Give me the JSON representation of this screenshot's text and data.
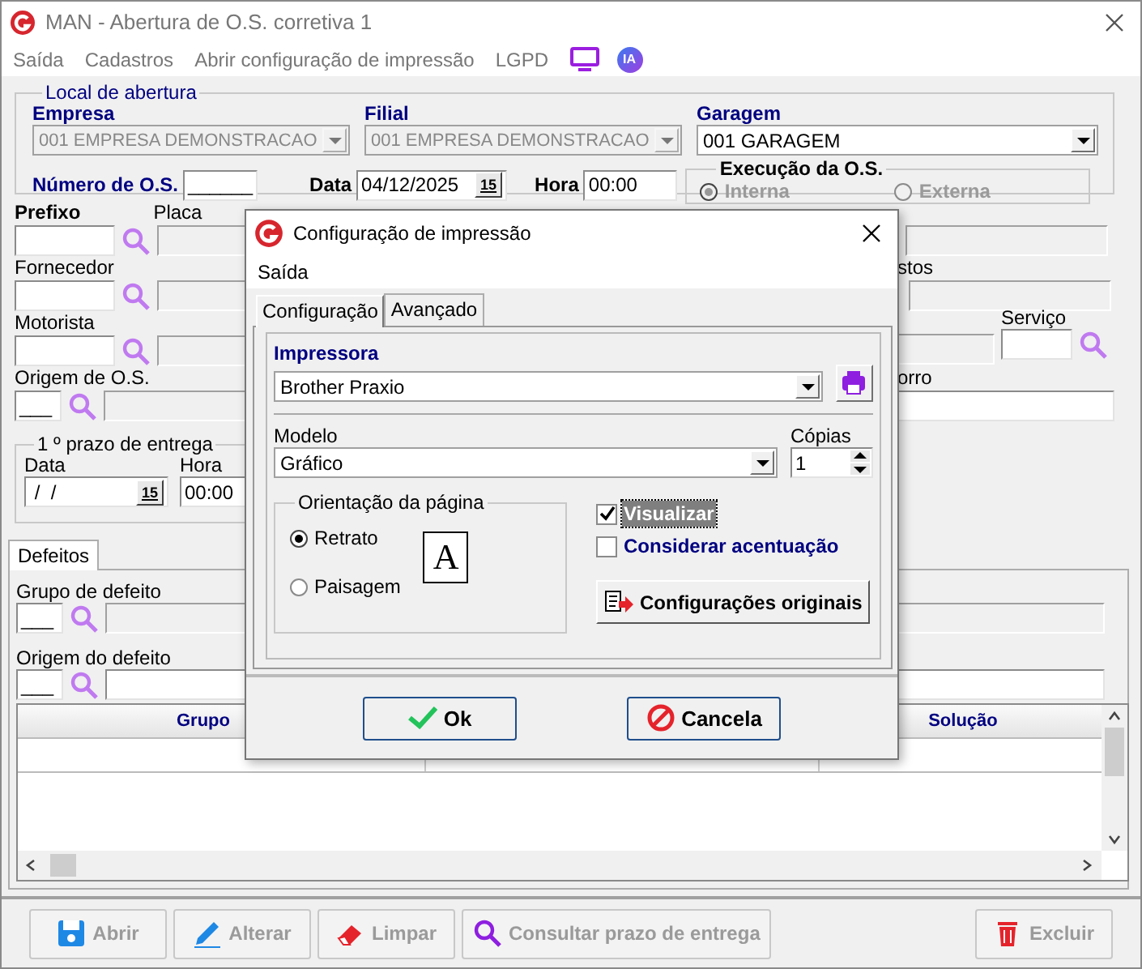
{
  "window": {
    "title": "MAN - Abertura de O.S. corretiva 1"
  },
  "menu": [
    {
      "label": "Saída"
    },
    {
      "label": "Cadastros"
    },
    {
      "label": "Abrir configuração de impressão"
    },
    {
      "label": "LGPD"
    }
  ],
  "menu_badge": "IA",
  "local_de_abertura": {
    "title": "Local de abertura",
    "empresa": {
      "label": "Empresa",
      "value": "001 EMPRESA DEMONSTRACAO",
      "disabled": true
    },
    "filial": {
      "label": "Filial",
      "value": "001 EMPRESA DEMONSTRACAO",
      "disabled": true
    },
    "garagem": {
      "label": "Garagem",
      "value": "001 GARAGEM",
      "disabled": false
    },
    "numero_os": {
      "label": "Número de O.S.",
      "value": "______"
    },
    "data": {
      "label": "Data",
      "value": "04/12/2025",
      "calendar": "15"
    },
    "hora": {
      "label": "Hora",
      "value": "00:00"
    },
    "execucao": {
      "title": "Execução da O.S.",
      "disabled": true,
      "options": [
        {
          "label": "Interna",
          "selected": true
        },
        {
          "label": "Externa",
          "selected": false
        }
      ]
    }
  },
  "vehicle_fields": [
    {
      "label": "Prefixo",
      "required": true,
      "second_label": "Placa",
      "kind": "lookup"
    },
    {
      "label": "Fornecedor",
      "required": false,
      "kind": "lookup"
    },
    {
      "label": "Motorista",
      "required": false,
      "kind": "lookup"
    },
    {
      "label": "Origem de O.S.",
      "required": false,
      "kind": "short",
      "value": "___"
    }
  ],
  "right_column": {
    "label_row_2": "stos",
    "servico_label": "Serviço",
    "label_row_4": "orro"
  },
  "prazo": {
    "title": "1 º prazo de entrega",
    "data": {
      "label": "Data",
      "value": " /  /",
      "calendar": "15"
    },
    "hora": {
      "label": "Hora",
      "value": "00:00"
    }
  },
  "defeitos": {
    "tabs": [
      {
        "label": "Defeitos",
        "selected": true
      }
    ],
    "grupo_de_defeito": {
      "label": "Grupo de defeito",
      "value": "___"
    },
    "origem_do_defeito": {
      "label": "Origem do defeito",
      "value": "___"
    },
    "table": {
      "columns": [
        "Grupo",
        "Solução"
      ]
    }
  },
  "toolbar": [
    {
      "label": "Abrir",
      "kind": "save",
      "disabled": true
    },
    {
      "label": "Alterar",
      "kind": "edit",
      "disabled": true
    },
    {
      "label": "Limpar",
      "kind": "eraser",
      "disabled": true
    },
    {
      "label": "Consultar prazo de entrega",
      "kind": "search",
      "disabled": true
    },
    {
      "label": "Excluir",
      "kind": "trash",
      "disabled": true
    }
  ],
  "dialog": {
    "title": "Configuração de impressão",
    "menu": [
      {
        "label": "Saída"
      }
    ],
    "tabs": [
      {
        "label": "Configuração",
        "selected": true
      },
      {
        "label": "Avançado",
        "selected": false
      }
    ],
    "impressora": {
      "label": "Impressora",
      "value": "Brother Praxio"
    },
    "modelo": {
      "label": "Modelo",
      "value": "Gráfico"
    },
    "copias": {
      "label": "Cópias",
      "value": "1"
    },
    "orientacao": {
      "title": "Orientação da página",
      "preview_letter": "A",
      "options": [
        {
          "label": "Retrato",
          "selected": true
        },
        {
          "label": "Paisagem",
          "selected": false
        }
      ]
    },
    "checks": [
      {
        "label": "Visualizar",
        "checked": true,
        "focused": true
      },
      {
        "label": "Considerar acentuação",
        "checked": false,
        "focused": false
      }
    ],
    "reset_button": "Configurações originais",
    "buttons": [
      {
        "label": "Ok",
        "kind": "ok"
      },
      {
        "label": "Cancela",
        "kind": "cancel"
      }
    ]
  }
}
